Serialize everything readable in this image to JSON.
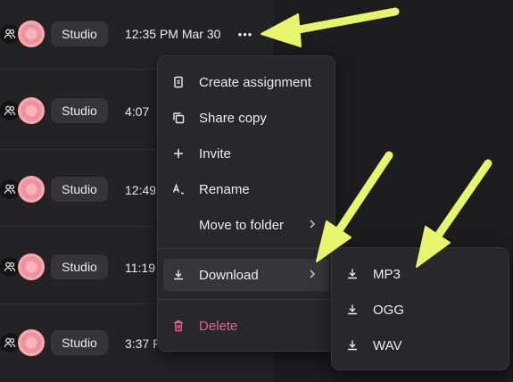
{
  "rows": [
    {
      "badge": "Studio",
      "time": "12:35 PM Mar 30",
      "more": "•••"
    },
    {
      "badge": "Studio",
      "time": "4:07"
    },
    {
      "badge": "Studio",
      "time": "12:49"
    },
    {
      "badge": "Studio",
      "time": "11:19 A"
    },
    {
      "badge": "Studio",
      "time": "3:37 P"
    }
  ],
  "menu": {
    "create_assignment": "Create assignment",
    "share_copy": "Share copy",
    "invite": "Invite",
    "rename": "Rename",
    "move_to_folder": "Move to folder",
    "download": "Download",
    "delete": "Delete"
  },
  "download_submenu": [
    "MP3",
    "OGG",
    "WAV"
  ],
  "colors": {
    "annotation_arrow": "#e6f56a",
    "delete": "#ef5b8a",
    "avatar": "#f7a9b1"
  },
  "icons": [
    "people-icon",
    "more-horizontal-icon",
    "assignment-icon",
    "copy-icon",
    "plus-icon",
    "rename-icon",
    "chevron-right-icon",
    "download-icon",
    "trash-icon"
  ]
}
